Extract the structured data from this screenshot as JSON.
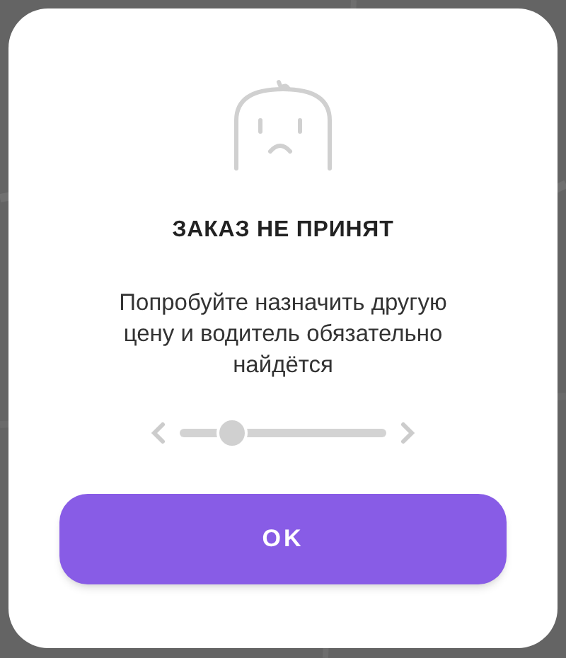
{
  "dialog": {
    "title": "ЗАКАЗ НЕ ПРИНЯТ",
    "message": "Попробуйте назначить другую цену и водитель обязательно найдётся",
    "price_slider": {
      "level": 0.25
    },
    "button": "OK"
  }
}
